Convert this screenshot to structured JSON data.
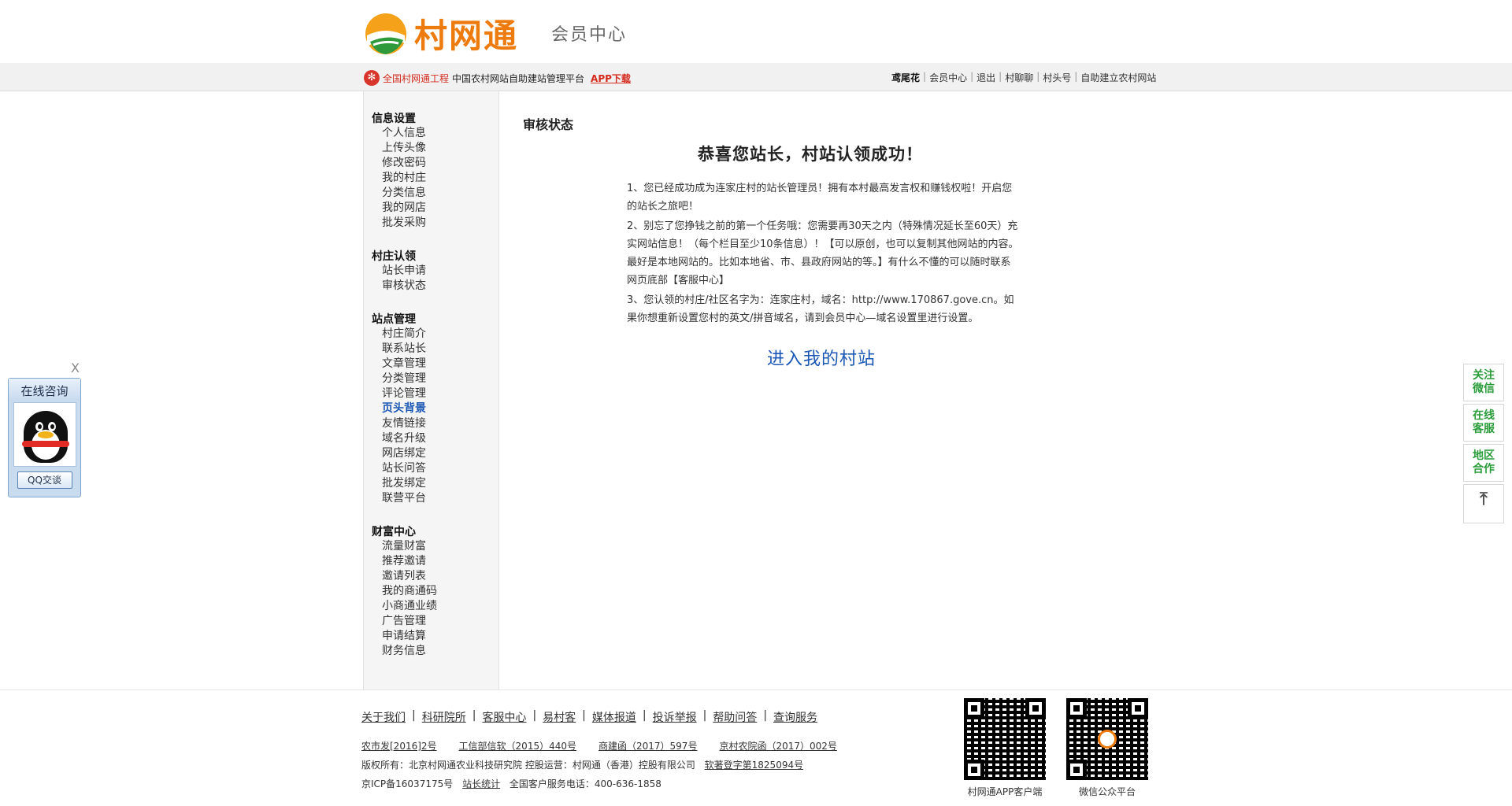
{
  "header": {
    "logo_text": "村网通",
    "subtitle": "会员中心"
  },
  "topbar": {
    "badge": "全国村网通工程",
    "slogan": "中国农村网站自助建站管理平台",
    "app": "APP下载",
    "right": {
      "user": "鸢尾花",
      "links": [
        "会员中心",
        "退出",
        "村聊聊",
        "村头号",
        "自助建立农村网站"
      ]
    }
  },
  "sidebar": {
    "groups": [
      {
        "title": "信息设置",
        "items": [
          "个人信息",
          "上传头像",
          "修改密码",
          "我的村庄",
          "分类信息",
          "我的网店",
          "批发采购"
        ]
      },
      {
        "title": "村庄认领",
        "items": [
          "站长申请",
          "审核状态"
        ]
      },
      {
        "title": "站点管理",
        "items": [
          "村庄简介",
          "联系站长",
          "文章管理",
          "分类管理",
          "评论管理",
          "页头背景",
          "友情链接",
          "域名升级",
          "网店绑定",
          "站长问答",
          "批发绑定",
          "联营平台"
        ]
      },
      {
        "title": "财富中心",
        "items": [
          "流量财富",
          "推荐邀请",
          "邀请列表",
          "我的商通码",
          "小商通业绩",
          "广告管理",
          "申请结算",
          "财务信息"
        ]
      }
    ],
    "active": "页头背景"
  },
  "main": {
    "section_title": "审核状态",
    "success": "恭喜您站长，村站认领成功！",
    "p1": "1、您已经成功成为连家庄村的站长管理员！拥有本村最高发言权和赚钱权啦！开启您的站长之旅吧！",
    "p2": "2、别忘了您挣钱之前的第一个任务哦：您需要再30天之内（特殊情况延长至60天）充实网站信息！（每个栏目至少10条信息）！【可以原创，也可以复制其他网站的内容。最好是本地网站的。比如本地省、市、县政府网站的等。】有什么不懂的可以随时联系网页底部【客服中心】",
    "p3": "3、您认领的村庄/社区名字为：连家庄村，域名：http://www.170867.gove.cn。如果你想重新设置您村的英文/拼音域名，请到会员中心—域名设置里进行设置。",
    "enter": "进入我的村站"
  },
  "footer": {
    "links": [
      "关于我们",
      "科研院所",
      "客服中心",
      "易村客",
      "媒体报道",
      "投诉举报",
      "帮助问答",
      "查询服务"
    ],
    "licenses": [
      "农市发[2016]2号",
      "工信部信软（2015）440号",
      "商建函（2017）597号",
      "京村农院函（2017）002号"
    ],
    "copyright_prefix": "版权所有：北京村网通农业科技研究院  控股运营：村网通（香港）控股有限公司",
    "copyright_link": "软著登字第1825094号",
    "icp": "京ICP备16037175号",
    "stats": "站长统计",
    "hotline": "全国客户服务电话：400-636-1858",
    "qr1": "村网通APP客户端",
    "qr2": "微信公众平台"
  },
  "qq": {
    "title": "在线咨询",
    "button": "QQ交谈",
    "close": "X"
  },
  "right_panel": {
    "items": [
      "关注微信",
      "在线客服",
      "地区合作"
    ],
    "top_icon": "back-to-top-icon"
  }
}
